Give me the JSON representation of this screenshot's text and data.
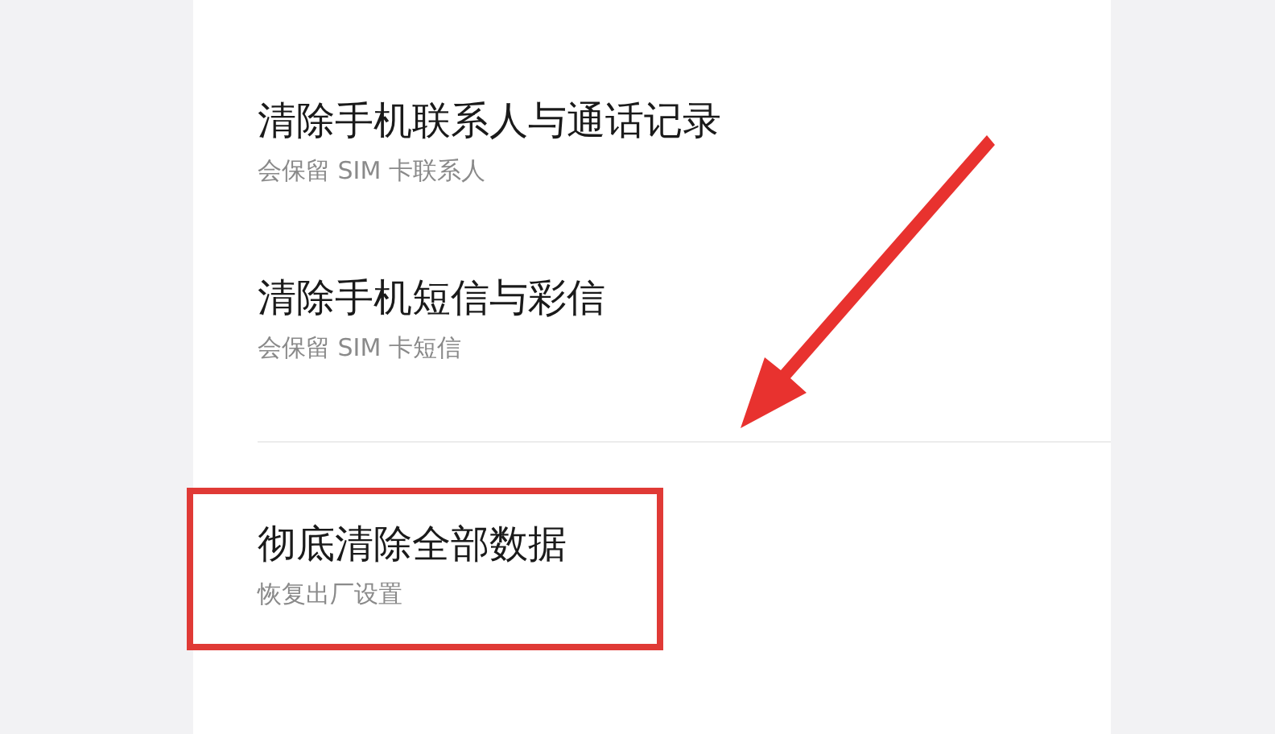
{
  "items": [
    {
      "title": "清除手机联系人与通话记录",
      "subtitle": "会保留 SIM 卡联系人",
      "highlighted": false
    },
    {
      "title": "清除手机短信与彩信",
      "subtitle": "会保留 SIM 卡短信",
      "highlighted": false
    },
    {
      "title": "彻底清除全部数据",
      "subtitle": "恢复出厂设置",
      "highlighted": true
    }
  ],
  "annotation_arrow": true
}
